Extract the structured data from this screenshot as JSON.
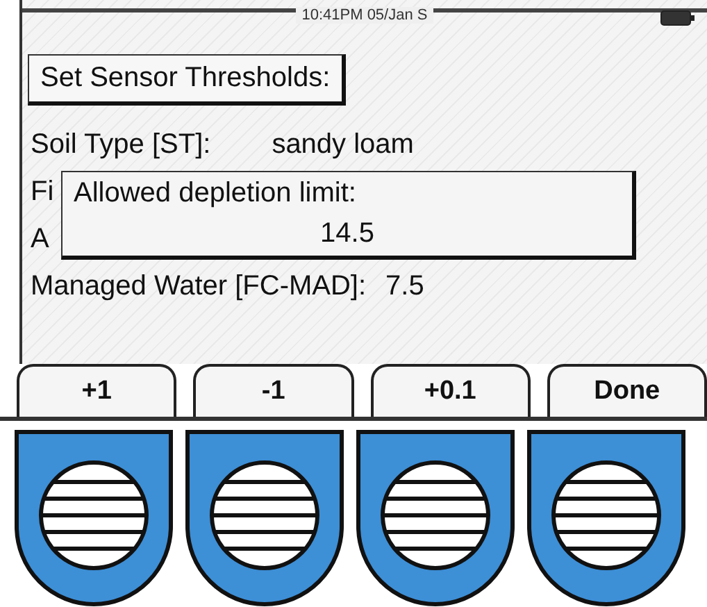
{
  "status_bar": {
    "time": "10:41PM 05/Jan S"
  },
  "screen_title": "Set Sensor Thresholds:",
  "rows": [
    {
      "label": "Soil Type [ST]:",
      "value": "sandy loam"
    },
    {
      "label": "Fi",
      "value": ""
    },
    {
      "label": "A",
      "value": ""
    },
    {
      "label": "Managed Water [FC-MAD]:",
      "value": "7.5"
    }
  ],
  "dialog": {
    "title": "Allowed depletion limit:",
    "value": "14.5"
  },
  "softkeys": [
    {
      "label": "+1"
    },
    {
      "label": "-1"
    },
    {
      "label": "+0.1"
    },
    {
      "label": "Done"
    }
  ]
}
